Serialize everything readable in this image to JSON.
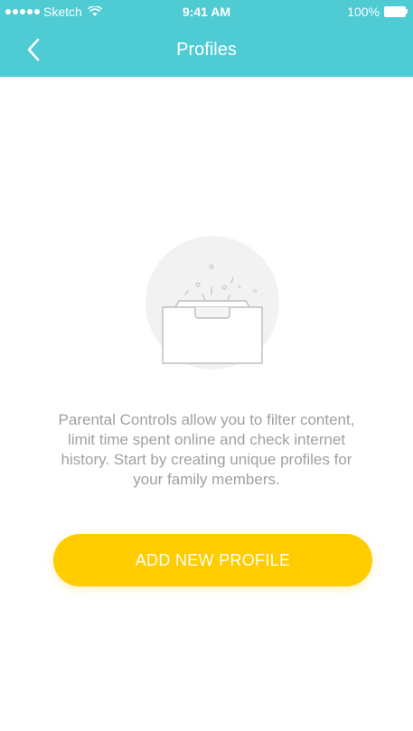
{
  "status_bar": {
    "carrier": "Sketch",
    "time": "9:41 AM",
    "battery": "100%"
  },
  "nav": {
    "title": "Profiles",
    "back_icon": "chevron-left-icon"
  },
  "empty_state": {
    "illustration": "open-box-icon",
    "message": "Parental Controls allow you to filter content, limit time spent online and check internet history. Start by creating unique profiles for your family members."
  },
  "actions": {
    "add_profile_label": "ADD NEW PROFILE"
  },
  "colors": {
    "header": "#4fcbd3",
    "primary_button": "#ffcc00",
    "text_muted": "#a0a0a0"
  }
}
